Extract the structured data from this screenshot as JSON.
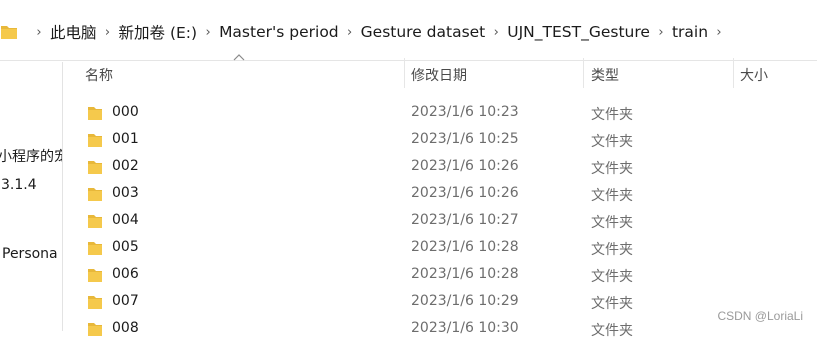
{
  "breadcrumb": {
    "items": [
      "此电脑",
      "新加卷 (E:)",
      "Master's period",
      "Gesture dataset",
      "UJN_TEST_Gesture",
      "train"
    ]
  },
  "nav_pane": {
    "items": [
      "小程序的宠",
      "3.1.4",
      "Persona"
    ]
  },
  "columns": {
    "name": "名称",
    "date_modified": "修改日期",
    "type": "类型",
    "size": "大小"
  },
  "files": [
    {
      "name": "000",
      "date": "2023/1/6 10:23",
      "type": "文件夹"
    },
    {
      "name": "001",
      "date": "2023/1/6 10:25",
      "type": "文件夹"
    },
    {
      "name": "002",
      "date": "2023/1/6 10:26",
      "type": "文件夹"
    },
    {
      "name": "003",
      "date": "2023/1/6 10:26",
      "type": "文件夹"
    },
    {
      "name": "004",
      "date": "2023/1/6 10:27",
      "type": "文件夹"
    },
    {
      "name": "005",
      "date": "2023/1/6 10:28",
      "type": "文件夹"
    },
    {
      "name": "006",
      "date": "2023/1/6 10:28",
      "type": "文件夹"
    },
    {
      "name": "007",
      "date": "2023/1/6 10:29",
      "type": "文件夹"
    },
    {
      "name": "008",
      "date": "2023/1/6 10:30",
      "type": "文件夹"
    }
  ],
  "watermark": "CSDN @LoriaLi",
  "icons": {
    "folder": "folder-icon",
    "chevron": "chevron-right-icon",
    "sort": "sort-ascending-icon"
  },
  "colors": {
    "folder_fill": "#f5c94c",
    "folder_tab": "#e8b83a",
    "secondary_text": "#6d6d6d"
  }
}
